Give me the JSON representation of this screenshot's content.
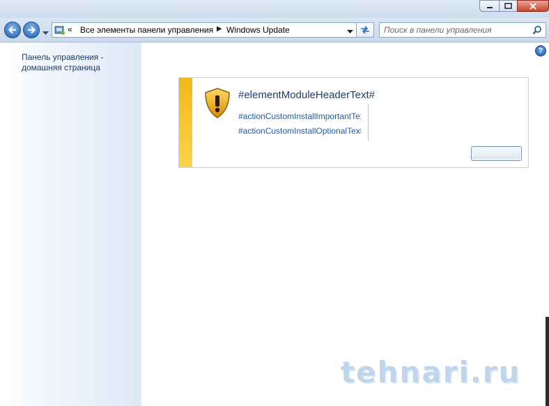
{
  "window": {
    "controls": [
      "minimize-icon",
      "maximize-icon",
      "close-icon"
    ]
  },
  "nav": {
    "back_icon": "back-arrow-icon",
    "forward_icon": "forward-arrow-icon",
    "recent_pages_icon": "chevron-down-icon"
  },
  "address_bar": {
    "icon": "control-panel-icon",
    "overflow_chevron": "«",
    "segments": [
      "Все элементы панели управления",
      "Windows Update"
    ],
    "separator": "▶"
  },
  "search": {
    "placeholder": "Поиск в панели управления",
    "value": ""
  },
  "sidebar": {
    "home_link": "Панель управления - домашняя страница"
  },
  "help": {
    "label": "?"
  },
  "module": {
    "header": "#elementModuleHeaderText#",
    "actions": [
      "#actionCustomInstallImportantText#",
      "#actionCustomInstallOptionalText#"
    ],
    "button_label": "",
    "icon": "warning-shield-icon",
    "accent_color": "#f6c12c"
  },
  "watermark": {
    "text": "tehnari.ru"
  }
}
